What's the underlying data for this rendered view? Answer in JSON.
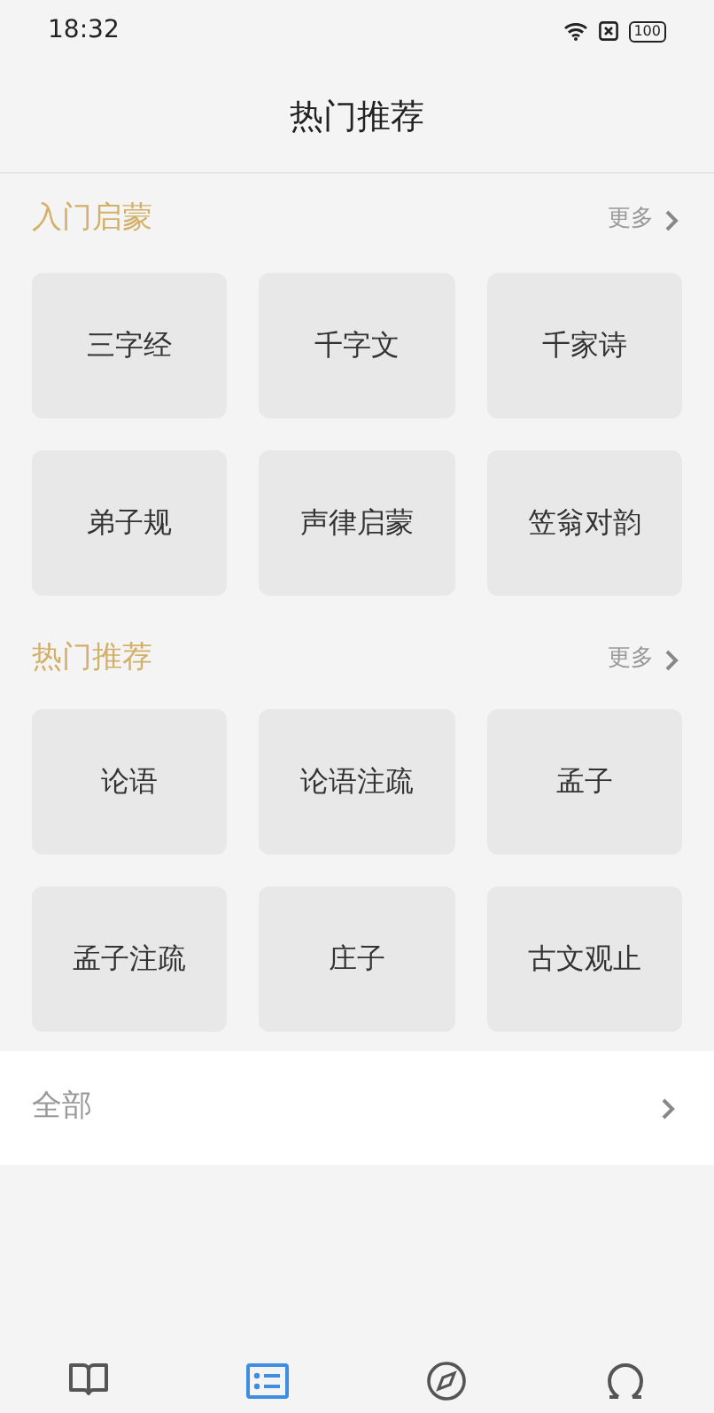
{
  "status_bar": {
    "time": "18:32",
    "battery": "100"
  },
  "title": "热门推荐",
  "sections": [
    {
      "title": "入门启蒙",
      "more": "更多",
      "books": [
        "三字经",
        "千字文",
        "千家诗",
        "弟子规",
        "声律启蒙",
        "笠翁对韵"
      ]
    },
    {
      "title": "热门推荐",
      "more": "更多",
      "books": [
        "论语",
        "论语注疏",
        "孟子",
        "孟子注疏",
        "庄子",
        "古文观止"
      ]
    }
  ],
  "all_row": {
    "label": "全部"
  },
  "tabs": [
    {
      "kind": "book",
      "selected": false
    },
    {
      "kind": "list",
      "selected": true
    },
    {
      "kind": "compass",
      "selected": false
    },
    {
      "kind": "person",
      "selected": false
    }
  ]
}
